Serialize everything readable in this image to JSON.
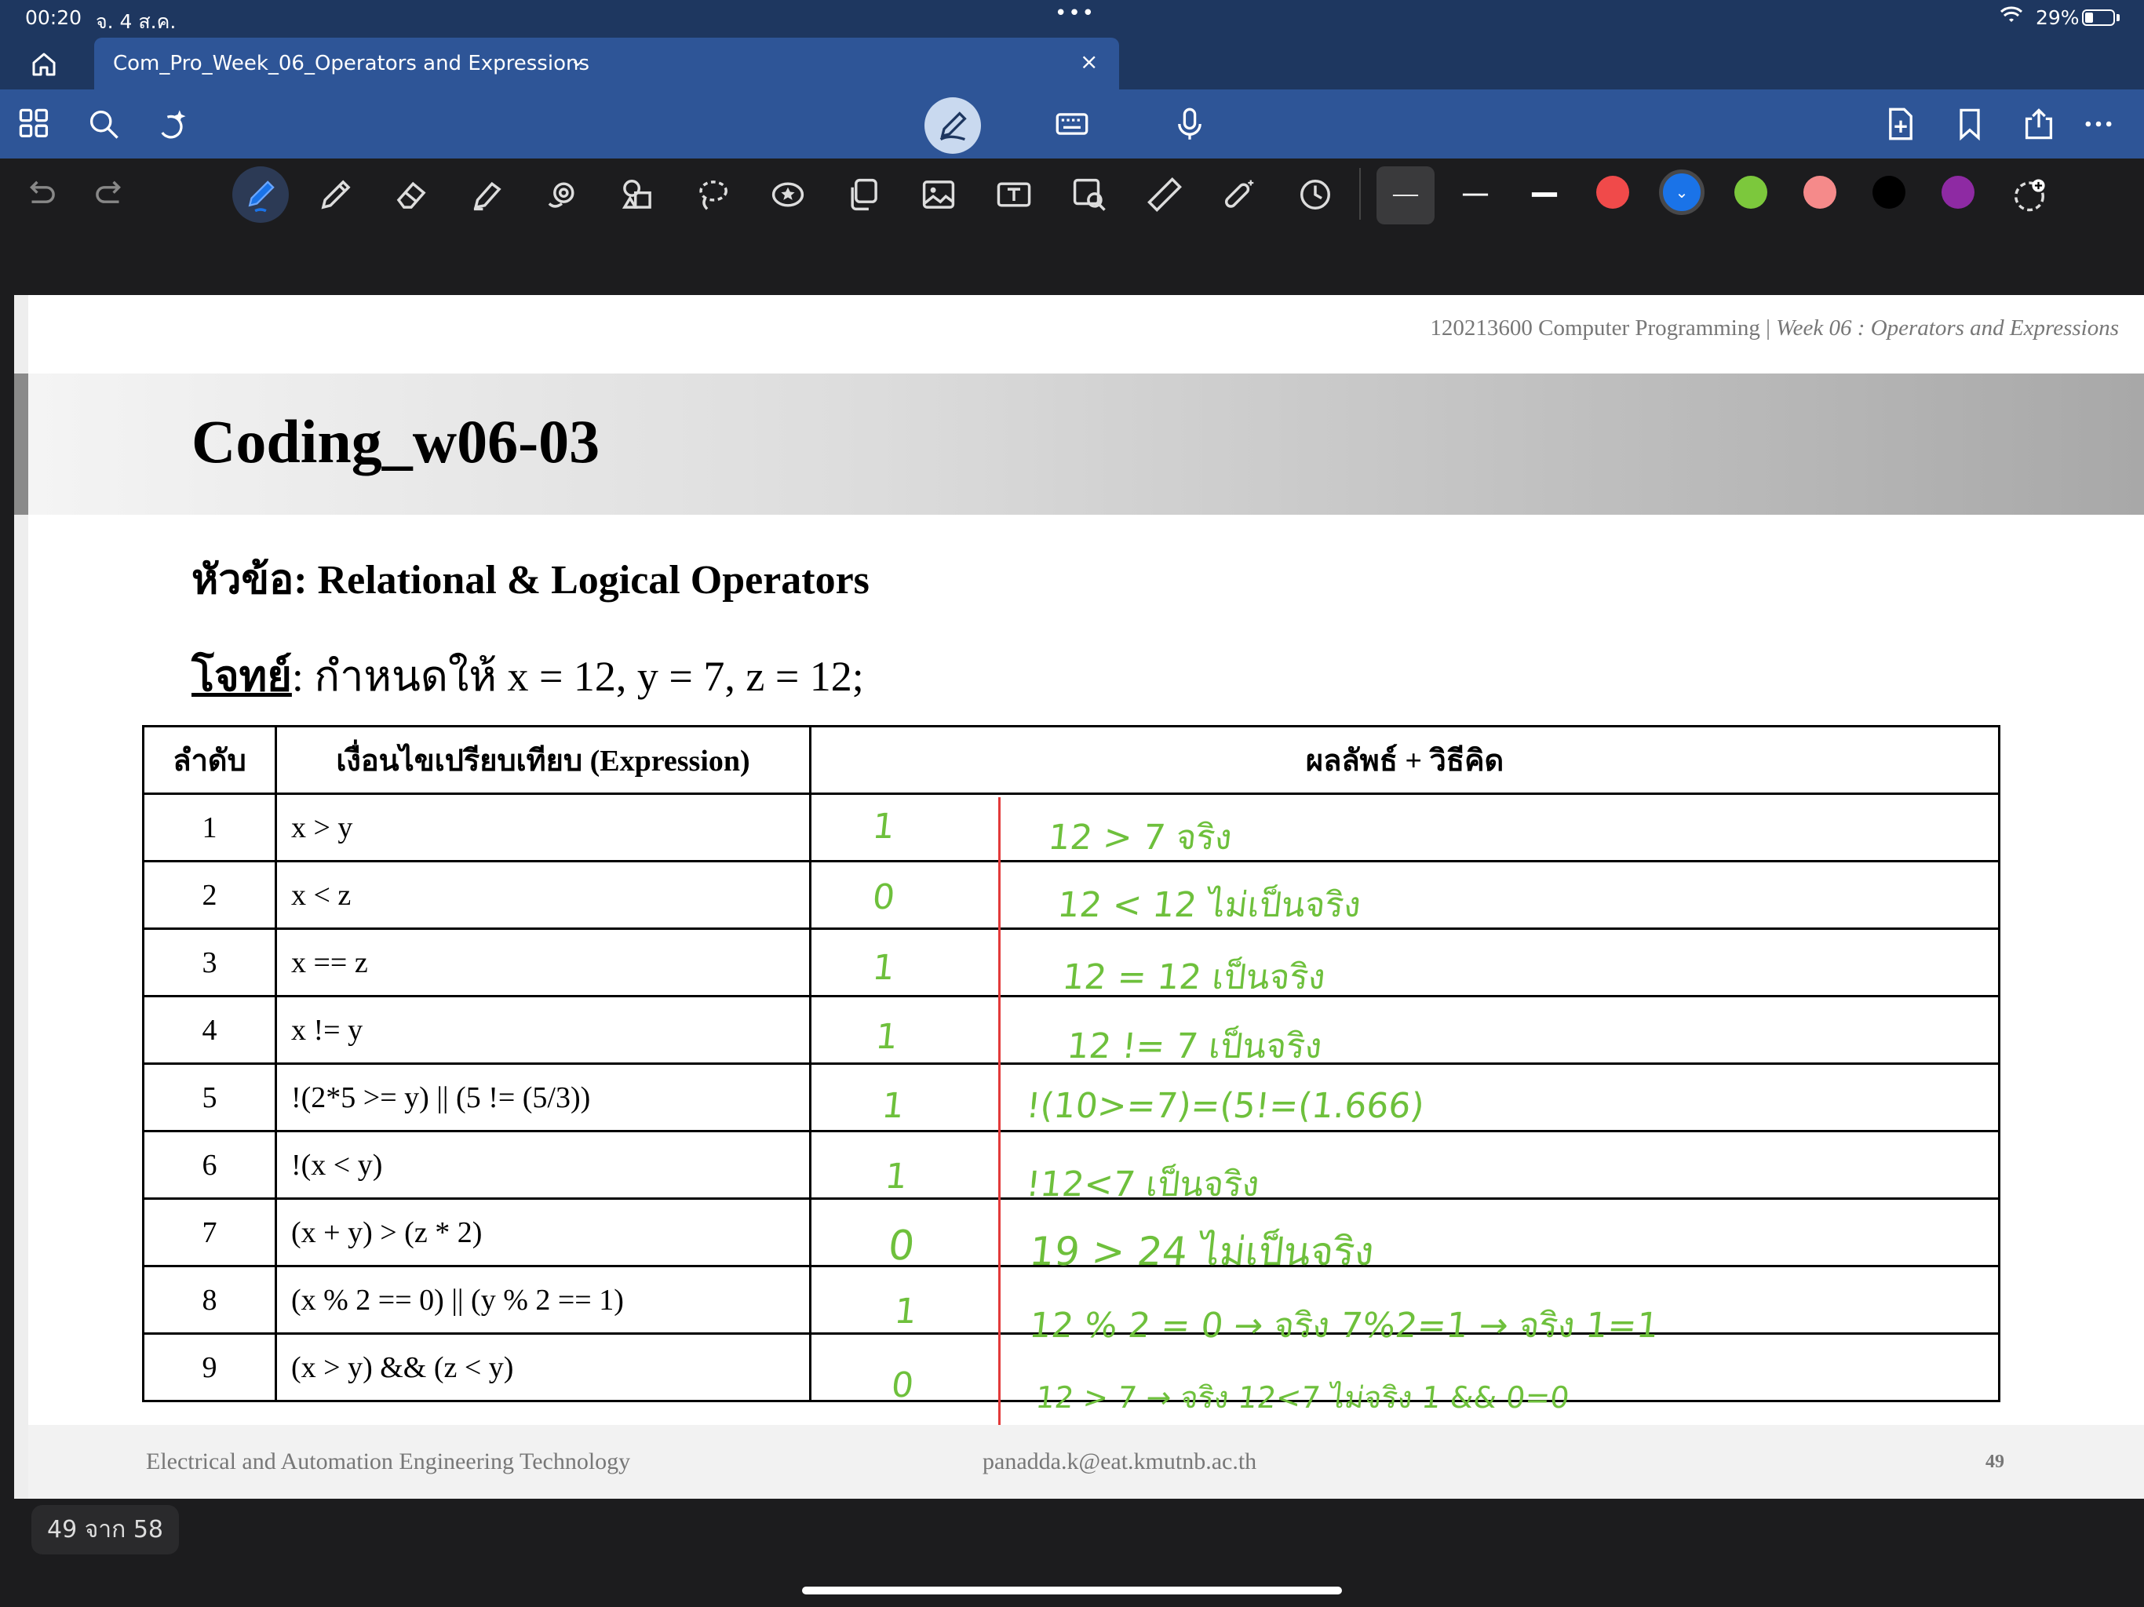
{
  "status": {
    "time": "00:20",
    "date": "จ. 4 ส.ค.",
    "battery": "29%"
  },
  "tab": {
    "title": "Com_Pro_Week_06_Operators and Expressions",
    "chevron": "⌄",
    "close": "×"
  },
  "toolbar_icons": [
    "thumbnails-icon",
    "search-icon",
    "ai-sparkle-icon",
    "pen-mode-icon",
    "keyboard-icon",
    "microphone-icon",
    "add-page-icon",
    "bookmark-icon",
    "share-icon",
    "more-icon"
  ],
  "tools": [
    "undo-icon",
    "redo-icon",
    "pen-icon",
    "pencil-icon",
    "eraser-icon",
    "highlighter-icon",
    "shapes-icon",
    "elements-icon",
    "lasso-icon",
    "sticker-icon",
    "copy-icon",
    "image-icon",
    "text-icon",
    "image-scan-icon",
    "ruler-icon",
    "laser-pointer-icon",
    "timer-icon"
  ],
  "colors": {
    "red": "#f04a4a",
    "blue": "#1a73e8",
    "green": "#7cc83c",
    "pink": "#f58a8a",
    "black": "#000000",
    "purple": "#8e2aa3",
    "handwriting": "#6ec03c",
    "accent": "#2e5597"
  },
  "doc": {
    "header_course": "120213600 Computer Programming |",
    "header_week": "Week 06 : Operators and Expressions",
    "title": "Coding_w06-03",
    "topic": "หัวข้อ: Relational & Logical Operators",
    "problem_label": "โจทย์",
    "problem_text": ": กำหนดให้ x = 12, y = 7, z = 12;",
    "table": {
      "headers": [
        "ลำดับ",
        "เงื่อนไขเปรียบเทียบ (Expression)",
        "ผลลัพธ์ + วิธีคิด"
      ],
      "rows": [
        {
          "no": "1",
          "expr": "x > y",
          "result": "1",
          "note": "12 > 7   จริง"
        },
        {
          "no": "2",
          "expr": "x < z",
          "result": "0",
          "note": "12 < 12   ไม่เป็นจริง"
        },
        {
          "no": "3",
          "expr": "x == z",
          "result": "1",
          "note": "12 = 12      เป็นจริง"
        },
        {
          "no": "4",
          "expr": "x != y",
          "result": "1",
          "note": "12 != 7       เป็นจริง"
        },
        {
          "no": "5",
          "expr": "!(2*5 >= y) || (5 != (5/3))",
          "result": "1",
          "note": "!(10>=7)=(5!=(1.666)"
        },
        {
          "no": "6",
          "expr": "!(x < y)",
          "result": "1",
          "note": "!12<7    เป็นจริง"
        },
        {
          "no": "7",
          "expr": "(x + y) > (z * 2)",
          "result": "0",
          "note": "19 > 24  ไม่เป็นจริง"
        },
        {
          "no": "8",
          "expr": "(x % 2 == 0) || (y % 2 == 1)",
          "result": "1",
          "note": "12 % 2 = 0 → จริง  7%2=1 → จริง    1=1"
        },
        {
          "no": "9",
          "expr": "(x > y) && (z < y)",
          "result": "0",
          "note": "12 > 7 → จริง  12<7 ไม่จริง  1 && 0=0"
        }
      ]
    },
    "footer_left": "Electrical and Automation Engineering Technology",
    "footer_email": "panadda.k@eat.kmutnb.ac.th",
    "page_number": "49"
  },
  "page_indicator": "49 จาก 58"
}
